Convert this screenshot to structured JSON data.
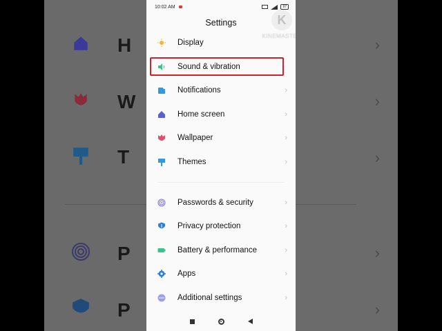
{
  "status_bar": {
    "time": "10:02 AM",
    "battery": "97"
  },
  "header": {
    "title": "Settings"
  },
  "watermark": {
    "text": "KINEMASTER",
    "logo_letter": "K"
  },
  "settings_items": [
    {
      "label": "Display",
      "icon": "sun-icon",
      "color": "#f5b82e"
    },
    {
      "label": "Sound & vibration",
      "icon": "speaker-icon",
      "color": "#35c48a"
    },
    {
      "label": "Notifications",
      "icon": "notification-icon",
      "color": "#2f9ae0"
    },
    {
      "label": "Home screen",
      "icon": "home-icon",
      "color": "#5b5fd6"
    },
    {
      "label": "Wallpaper",
      "icon": "tulip-icon",
      "color": "#e0506a"
    },
    {
      "label": "Themes",
      "icon": "paint-roller-icon",
      "color": "#2f9ae0"
    },
    {
      "label": "Passwords & security",
      "icon": "fingerprint-icon",
      "color": "#7a6fd8"
    },
    {
      "label": "Privacy protection",
      "icon": "shield-icon",
      "color": "#2f7fd8"
    },
    {
      "label": "Battery & performance",
      "icon": "battery-icon",
      "color": "#35c48a"
    },
    {
      "label": "Apps",
      "icon": "gear-icon",
      "color": "#2f7fd8"
    },
    {
      "label": "Additional settings",
      "icon": "more-icon",
      "color": "#7a7fe0"
    }
  ],
  "highlight_color": "#d0202a",
  "background_ghost_letters": [
    "H",
    "W",
    "T",
    "P",
    "P"
  ]
}
